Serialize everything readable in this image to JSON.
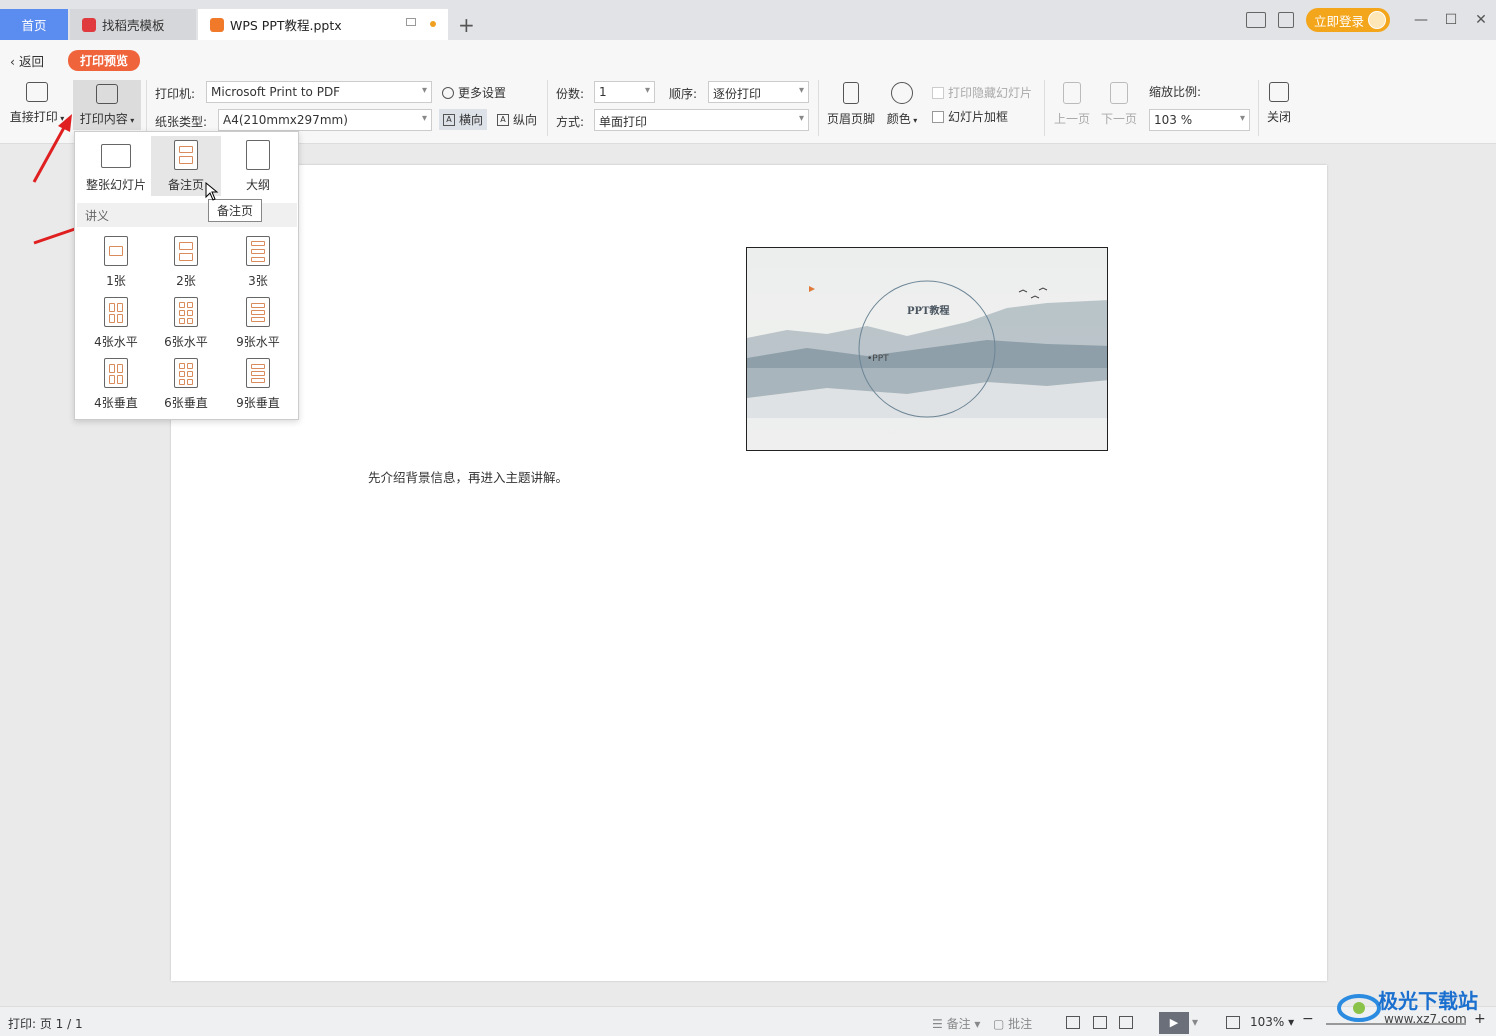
{
  "tabs": {
    "home": "首页",
    "template": "找稻壳模板",
    "document": "WPS PPT教程.pptx"
  },
  "titlebar": {
    "login": "立即登录"
  },
  "toolbar": {
    "back": "返回",
    "preview_badge": "打印预览",
    "direct_print": "直接打印",
    "print_content": "打印内容",
    "printer_label": "打印机:",
    "printer_value": "Microsoft Print to PDF",
    "more_settings": "更多设置",
    "paper_label": "纸张类型:",
    "paper_value": "A4(210mmx297mm)",
    "landscape": "横向",
    "portrait": "纵向",
    "copies_label": "份数:",
    "copies_value": "1",
    "order_label": "顺序:",
    "order_value": "逐份打印",
    "mode_label": "方式:",
    "mode_value": "单面打印",
    "header_footer": "页眉页脚",
    "color": "颜色",
    "print_hidden": "打印隐藏幻灯片",
    "slide_frame": "幻灯片加框",
    "prev_page": "上一页",
    "next_page": "下一页",
    "zoom_label": "缩放比例:",
    "zoom_value": "103 %",
    "close": "关闭"
  },
  "dropdown": {
    "top_items": [
      "整张幻灯片",
      "备注页",
      "大纲"
    ],
    "section": "讲义",
    "handouts": [
      "1张",
      "2张",
      "3张",
      "4张水平",
      "6张水平",
      "9张水平",
      "4张垂直",
      "6张垂直",
      "9张垂直"
    ],
    "tooltip": "备注页"
  },
  "slide": {
    "title": "PPT教程",
    "bullet": "•PPT"
  },
  "page": {
    "notes": "先介绍背景信息，再进入主题讲解。"
  },
  "status": {
    "print_page": "打印: 页 1 / 1",
    "notes": "备注",
    "comments": "批注",
    "zoom": "103%"
  },
  "watermark": {
    "brand": "极光下载站",
    "url": "www.xz7.com"
  },
  "colors": {
    "accent_orange": "#f0643c",
    "tab_blue": "#5b8cf0",
    "login_orange": "#f3a51b"
  }
}
